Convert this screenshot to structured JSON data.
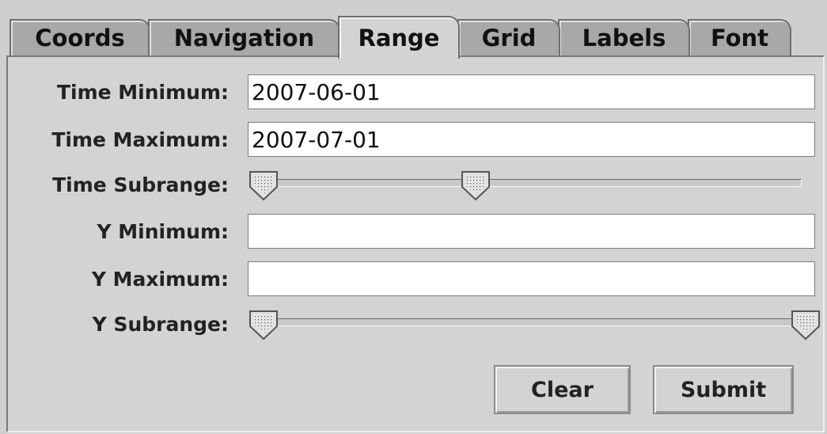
{
  "tabs": [
    {
      "label": "Coords",
      "active": false
    },
    {
      "label": "Navigation",
      "active": false
    },
    {
      "label": "Range",
      "active": true
    },
    {
      "label": "Grid",
      "active": false
    },
    {
      "label": "Labels",
      "active": false
    },
    {
      "label": "Font",
      "active": false
    }
  ],
  "form": {
    "time_min_label": "Time Minimum:",
    "time_min_value": "2007-06-01",
    "time_max_label": "Time Maximum:",
    "time_max_value": "2007-07-01",
    "time_subrange_label": "Time Subrange:",
    "time_subrange": {
      "low": 0.0,
      "high": 0.4
    },
    "y_min_label": "Y Minimum:",
    "y_min_value": "",
    "y_max_label": "Y Maximum:",
    "y_max_value": "",
    "y_subrange_label": "Y Subrange:",
    "y_subrange": {
      "low": 0.0,
      "high": 1.0
    }
  },
  "buttons": {
    "clear_label": "Clear",
    "submit_label": "Submit"
  }
}
